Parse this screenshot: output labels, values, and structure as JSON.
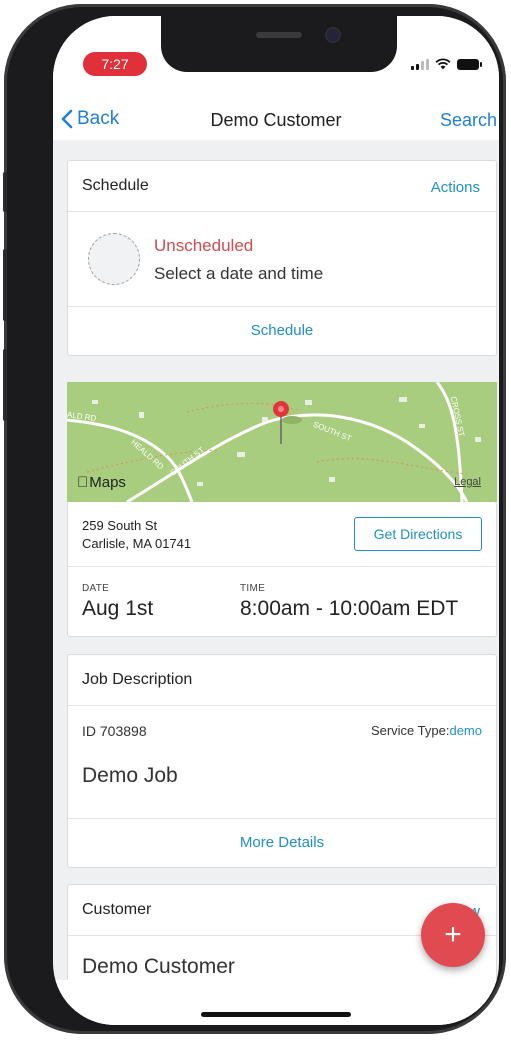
{
  "status": {
    "time": "7:27"
  },
  "nav": {
    "back": "Back",
    "title": "Demo Customer",
    "search": "Search"
  },
  "schedule": {
    "title": "Schedule",
    "action": "Actions",
    "state": "Unscheduled",
    "prompt": "Select a date and time",
    "link": "Schedule"
  },
  "map": {
    "brand": "Maps",
    "legal": "Legal",
    "labels": [
      "ALD RD",
      "HEALD RD",
      "SOUTH ST",
      "SOUTH ST",
      "CROSS ST"
    ]
  },
  "address": {
    "line1": "259 South St",
    "line2": "Carlisle, MA 01741",
    "directions": "Get Directions",
    "date_label": "DATE",
    "date_value": "Aug 1st",
    "time_label": "TIME",
    "time_value": "8:00am - 10:00am EDT"
  },
  "job": {
    "title": "Job Description",
    "id": "ID 703898",
    "service_label": "Service Type:",
    "service_value": "demo",
    "name": "Demo Job",
    "link": "More Details"
  },
  "customer": {
    "title": "Customer",
    "action": "View",
    "name": "Demo Customer"
  },
  "fab": {
    "label": "+"
  },
  "colors": {
    "accent": "#1f8fc9",
    "nav_link": "#1f7fd6",
    "unscheduled": "#d14b4f",
    "fab": "#e14a50",
    "map": "#a8cd7e"
  }
}
